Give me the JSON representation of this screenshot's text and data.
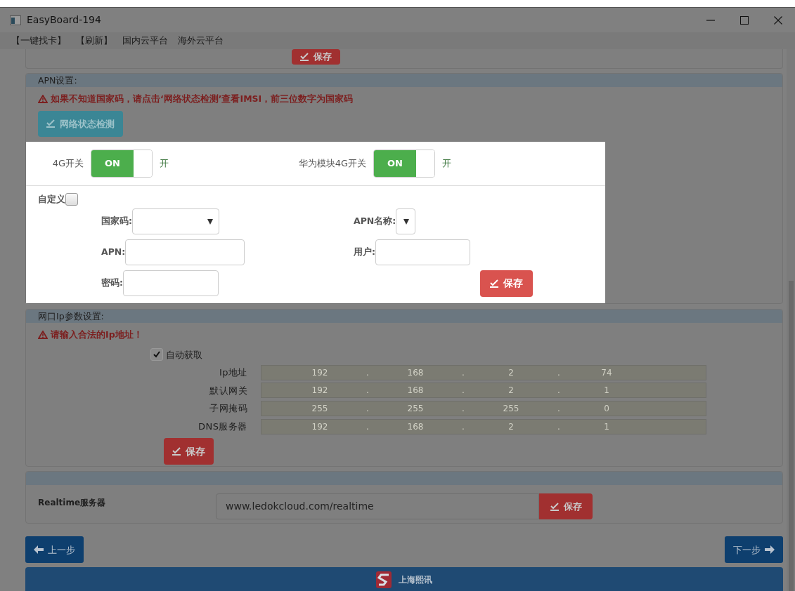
{
  "window": {
    "title": "EasyBoard-194"
  },
  "menu": [
    {
      "label": "【一键找卡】"
    },
    {
      "label": "【刷新】"
    },
    {
      "label": "国内云平台"
    },
    {
      "label": "海外云平台"
    }
  ],
  "top_card": {
    "save_button": "保存"
  },
  "apn": {
    "title": "APN设置:",
    "warning": "如果不知道国家码，请点击‘网络状态检测’查看IMSI，前三位数字为国家码",
    "check_button": "网络状态检测",
    "switches": [
      {
        "label": "4G开关",
        "on": true,
        "switch_text": "ON",
        "state_text": "开"
      },
      {
        "label": "华为模块4G开关",
        "on": true,
        "switch_text": "ON",
        "state_text": "开"
      }
    ],
    "custom": {
      "label": "自定义",
      "checked": false
    },
    "fields": [
      {
        "label": "国家码:",
        "kind": "select"
      },
      {
        "label": "APN名称:",
        "kind": "select"
      },
      {
        "label": "APN:",
        "kind": "input"
      },
      {
        "label": "用户:",
        "kind": "input"
      },
      {
        "label": "密码:",
        "kind": "input"
      }
    ],
    "save_button": "保存"
  },
  "ip": {
    "title": "网口Ip参数设置:",
    "warning": "请输入合法的Ip地址！",
    "auto": {
      "label": "自动获取",
      "checked": true
    },
    "rows": [
      {
        "label": "Ip地址",
        "parts": [
          "192",
          ".",
          "168",
          ".",
          "2",
          ".",
          "74"
        ]
      },
      {
        "label": "默认网关",
        "parts": [
          "192",
          ".",
          "168",
          ".",
          "2",
          ".",
          "1"
        ]
      },
      {
        "label": "子网掩码",
        "parts": [
          "255",
          ".",
          "255",
          ".",
          "255",
          ".",
          "0"
        ]
      },
      {
        "label": "DNS服务器",
        "parts": [
          "192",
          ".",
          "168",
          ".",
          "2",
          ".",
          "1"
        ]
      }
    ],
    "save_button": "保存"
  },
  "realtime": {
    "label": "Realtime服务器",
    "value": "www.ledokcloud.com/realtime",
    "save_button": "保存"
  },
  "nav": {
    "prev": "上一步",
    "next": "下一步"
  },
  "footer": {
    "text": "上海熙讯"
  }
}
